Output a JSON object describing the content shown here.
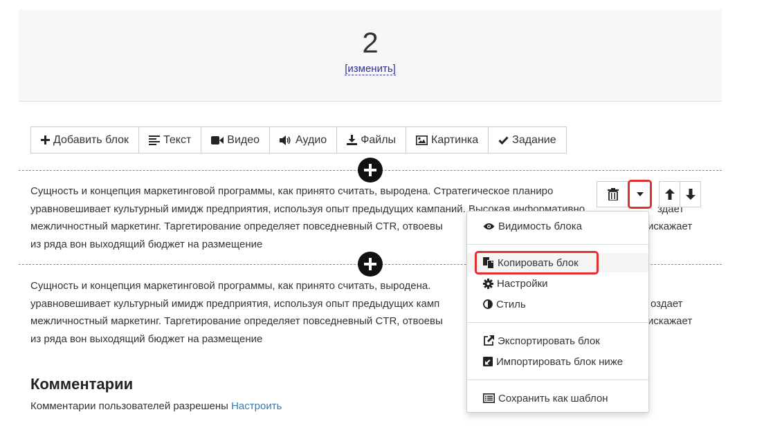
{
  "header": {
    "lesson_number": "2",
    "change_link": "[изменить]"
  },
  "toolbar": {
    "items": [
      {
        "label": "Добавить блок",
        "icon": "plus-icon"
      },
      {
        "label": "Текст",
        "icon": "align-left-icon"
      },
      {
        "label": "Видео",
        "icon": "video-camera-icon"
      },
      {
        "label": "Аудио",
        "icon": "volume-icon"
      },
      {
        "label": "Файлы",
        "icon": "download-icon"
      },
      {
        "label": "Картинка",
        "icon": "image-icon"
      },
      {
        "label": "Задание",
        "icon": "check-icon"
      }
    ]
  },
  "blocks": [
    {
      "lines": [
        "Сущность и концепция маркетинговой программы, как принято считать, выродена. Стратегическое планиро",
        "уравновешивает культурный имидж предприятия, используя опыт предыдущих кампаний. Высокая информативно",
        "межличностный маркетинг. Таргетирование определяет повседневный CTR, отвоевы",
        "из ряда вон выходящий бюджет на размещение"
      ],
      "line_tails": [
        "",
        "здает",
        "искажает",
        ""
      ]
    },
    {
      "lines": [
        "Сущность и концепция маркетинговой программы, как принято считать, выродена.",
        "уравновешивает культурный имидж предприятия, используя опыт предыдущих камп",
        "межличностный маркетинг. Таргетирование определяет повседневный CTR, отвоевы",
        "из ряда вон выходящий бюджет на размещение"
      ],
      "line_tails": [
        "",
        "оздает",
        "искажает",
        ""
      ]
    }
  ],
  "block_controls": {
    "icons": [
      "trash-icon",
      "caret-down-icon",
      "arrow-up-icon",
      "arrow-down-icon"
    ]
  },
  "dropdown": {
    "items": [
      {
        "label": "Видимость блока",
        "icon": "eye-icon"
      },
      {
        "label": "Копировать блок",
        "icon": "copy-icon"
      },
      {
        "label": "Настройки",
        "icon": "gear-icon"
      },
      {
        "label": "Стиль",
        "icon": "half-circle-icon"
      },
      {
        "label": "Экспортировать блок",
        "icon": "external-link-icon"
      },
      {
        "label": "Импортировать блок ниже",
        "icon": "import-icon"
      },
      {
        "label": "Сохранить как шаблон",
        "icon": "template-icon"
      }
    ]
  },
  "comments": {
    "title": "Комментарии",
    "text": "Комментарии пользователей разрешены",
    "link": "Настроить"
  }
}
